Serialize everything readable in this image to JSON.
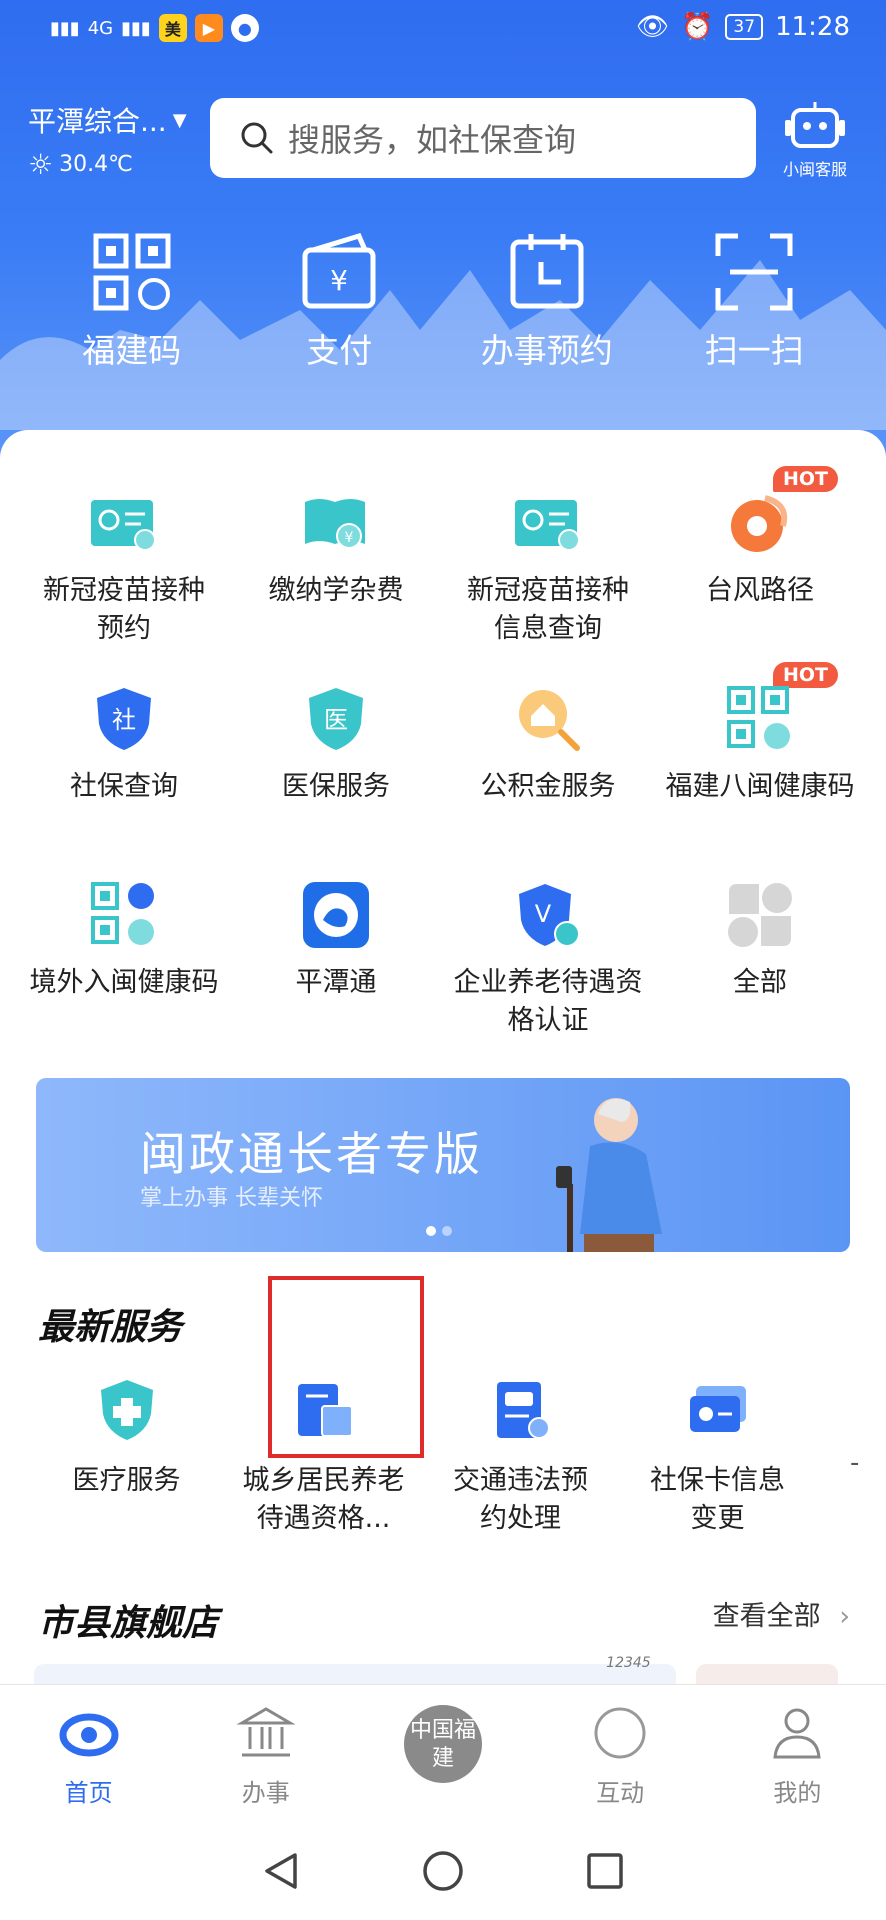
{
  "status_bar": {
    "network1": "4G",
    "network2": "4G",
    "app_badges": [
      "美",
      "▶",
      "●"
    ],
    "battery": "37",
    "time": "11:28"
  },
  "header": {
    "location": "平潭综合...",
    "weather": "30.4℃",
    "search_placeholder": "搜服务，如社保查询",
    "assistant_label": "小闽客服",
    "quick_actions": [
      {
        "label": "福建码",
        "icon": "qr-health-icon"
      },
      {
        "label": "支付",
        "icon": "wallet-icon"
      },
      {
        "label": "办事预约",
        "icon": "calendar-icon"
      },
      {
        "label": "扫一扫",
        "icon": "scan-icon"
      }
    ]
  },
  "services": [
    {
      "label": "新冠疫苗接种预约",
      "icon": "vaccine-appointment-icon",
      "hot": false
    },
    {
      "label": "缴纳学杂费",
      "icon": "tuition-icon",
      "hot": false
    },
    {
      "label": "新冠疫苗接种信息查询",
      "icon": "vaccine-query-icon",
      "hot": false
    },
    {
      "label": "台风路径",
      "icon": "typhoon-icon",
      "hot": true
    },
    {
      "label": "社保查询",
      "icon": "social-security-icon",
      "hot": false
    },
    {
      "label": "医保服务",
      "icon": "medical-insurance-icon",
      "hot": false
    },
    {
      "label": "公积金服务",
      "icon": "housing-fund-icon",
      "hot": false
    },
    {
      "label": "福建八闽健康码",
      "icon": "health-code-icon",
      "hot": true
    },
    {
      "label": "境外入闽健康码",
      "icon": "overseas-health-code-icon",
      "hot": false
    },
    {
      "label": "平潭通",
      "icon": "pingtan-app-icon",
      "hot": false
    },
    {
      "label": "企业养老待遇资格认证",
      "icon": "pension-verify-icon",
      "hot": false
    },
    {
      "label": "全部",
      "icon": "all-apps-icon",
      "hot": false
    }
  ],
  "hot_badge": "HOT",
  "banner": {
    "title": "闽政通长者专版",
    "subtitle": "掌上办事  长辈关怀"
  },
  "latest_services": {
    "title": "最新服务",
    "items": [
      {
        "label": "医疗服务",
        "icon": "medical-service-icon"
      },
      {
        "label": "城乡居民养老待遇资格...",
        "icon": "pension-doc-icon"
      },
      {
        "label": "交通违法预约处理",
        "icon": "traffic-icon"
      },
      {
        "label": "社保卡信息变更",
        "icon": "ss-card-icon"
      }
    ],
    "trailing": "-"
  },
  "flagship": {
    "title": "市县旗舰店",
    "see_all": "查看全部"
  },
  "tabs": [
    {
      "label": "首页",
      "active": true
    },
    {
      "label": "办事",
      "active": false
    },
    {
      "label": "中国福建",
      "active": false
    },
    {
      "label": "互动",
      "active": false
    },
    {
      "label": "我的",
      "active": false
    }
  ],
  "tab_center_badge": "12345",
  "colors": {
    "primary": "#2f6df0",
    "highlight_box": "#e02b2b",
    "hot": "#f35b40",
    "teal": "#39c5c9"
  }
}
